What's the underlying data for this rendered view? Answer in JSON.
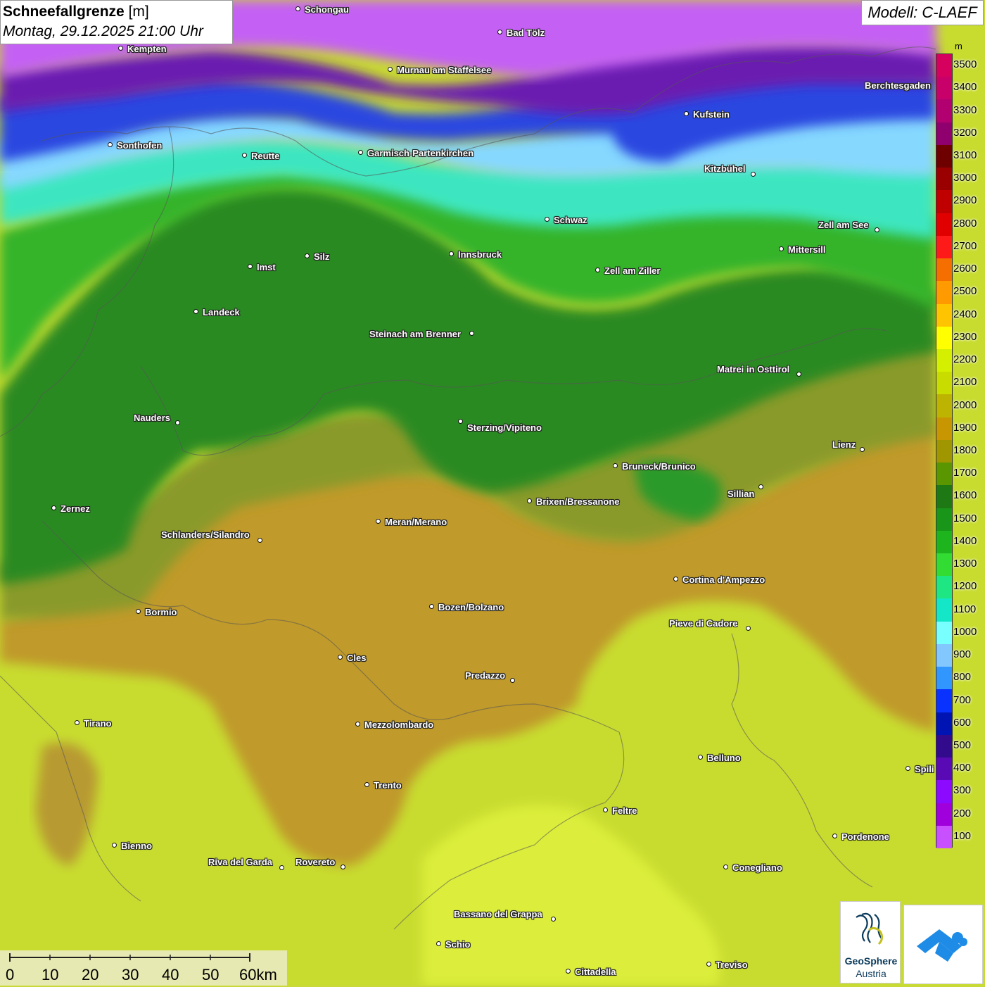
{
  "title": {
    "main": "Schneefallgrenze",
    "unit": "[m]",
    "datetime": "Montag, 29.12.2025 21:00 Uhr"
  },
  "model": "Modell: C-LAEF",
  "legend": {
    "unit": "m",
    "levels": [
      {
        "value": "3500",
        "color": "#d6005f"
      },
      {
        "value": "3400",
        "color": "#c8006a"
      },
      {
        "value": "3300",
        "color": "#b30070"
      },
      {
        "value": "3200",
        "color": "#8f006e"
      },
      {
        "value": "3100",
        "color": "#6e0000"
      },
      {
        "value": "3000",
        "color": "#9a0000"
      },
      {
        "value": "2900",
        "color": "#c00000"
      },
      {
        "value": "2800",
        "color": "#e00000"
      },
      {
        "value": "2700",
        "color": "#ff1a1a"
      },
      {
        "value": "2600",
        "color": "#f56e00"
      },
      {
        "value": "2500",
        "color": "#ff9a00"
      },
      {
        "value": "2400",
        "color": "#ffc400"
      },
      {
        "value": "2300",
        "color": "#ffff00"
      },
      {
        "value": "2200",
        "color": "#d4f000"
      },
      {
        "value": "2100",
        "color": "#c8dc00"
      },
      {
        "value": "2000",
        "color": "#bcb400"
      },
      {
        "value": "1900",
        "color": "#c89600"
      },
      {
        "value": "1800",
        "color": "#a09600"
      },
      {
        "value": "1700",
        "color": "#5a9600"
      },
      {
        "value": "1600",
        "color": "#1e7814"
      },
      {
        "value": "1500",
        "color": "#199619"
      },
      {
        "value": "1400",
        "color": "#1eb41e"
      },
      {
        "value": "1300",
        "color": "#32dc32"
      },
      {
        "value": "1200",
        "color": "#1ee682"
      },
      {
        "value": "1100",
        "color": "#14e6c8"
      },
      {
        "value": "1000",
        "color": "#78ffff"
      },
      {
        "value": "900",
        "color": "#82c8ff"
      },
      {
        "value": "800",
        "color": "#3296ff"
      },
      {
        "value": "700",
        "color": "#0a32ff"
      },
      {
        "value": "600",
        "color": "#0014b4"
      },
      {
        "value": "500",
        "color": "#320a8c"
      },
      {
        "value": "400",
        "color": "#5a0ab4"
      },
      {
        "value": "300",
        "color": "#8c0aff"
      },
      {
        "value": "200",
        "color": "#a000dc"
      },
      {
        "value": "100",
        "color": "#c850ff"
      }
    ]
  },
  "cities": [
    {
      "name": "Schongau"
    },
    {
      "name": "Kempten"
    },
    {
      "name": "Bad Tölz"
    },
    {
      "name": "Murnau am Staffelsee"
    },
    {
      "name": "Berchtesgaden"
    },
    {
      "name": "Kufstein"
    },
    {
      "name": "Sonthofen"
    },
    {
      "name": "Reutte"
    },
    {
      "name": "Garmisch-Partenkirchen"
    },
    {
      "name": "Kitzbühel"
    },
    {
      "name": "Schwaz"
    },
    {
      "name": "Zell am See"
    },
    {
      "name": "Innsbruck"
    },
    {
      "name": "Mittersill"
    },
    {
      "name": "Imst"
    },
    {
      "name": "Silz"
    },
    {
      "name": "Zell am Ziller"
    },
    {
      "name": "Landeck"
    },
    {
      "name": "Steinach am Brenner"
    },
    {
      "name": "Matrei in Osttirol"
    },
    {
      "name": "Nauders"
    },
    {
      "name": "Sterzing/Vipiteno"
    },
    {
      "name": "Lienz"
    },
    {
      "name": "Bruneck/Brunico"
    },
    {
      "name": "Sillian"
    },
    {
      "name": "Brixen/Bressanone"
    },
    {
      "name": "Zernez"
    },
    {
      "name": "Meran/Merano"
    },
    {
      "name": "Schlanders/Silandro"
    },
    {
      "name": "Cortina d'Ampezzo"
    },
    {
      "name": "Bozen/Bolzano"
    },
    {
      "name": "Bormio"
    },
    {
      "name": "Pieve di Cadore"
    },
    {
      "name": "Cles"
    },
    {
      "name": "Predazzo"
    },
    {
      "name": "Tirano"
    },
    {
      "name": "Mezzolombardo"
    },
    {
      "name": "Belluno"
    },
    {
      "name": "Spili"
    },
    {
      "name": "Trento"
    },
    {
      "name": "Feltre"
    },
    {
      "name": "Pordenone"
    },
    {
      "name": "Bienno"
    },
    {
      "name": "Riva del Garda"
    },
    {
      "name": "Rovereto"
    },
    {
      "name": "Conegliano"
    },
    {
      "name": "Bassano del Grappa"
    },
    {
      "name": "Schio"
    },
    {
      "name": "Treviso"
    },
    {
      "name": "Cittadella"
    }
  ],
  "scale": {
    "labels": [
      "0",
      "10",
      "20",
      "30",
      "40",
      "50",
      "60km"
    ]
  },
  "logos": {
    "geosphere_line1": "GeoSphere",
    "geosphere_line2": "Austria"
  }
}
